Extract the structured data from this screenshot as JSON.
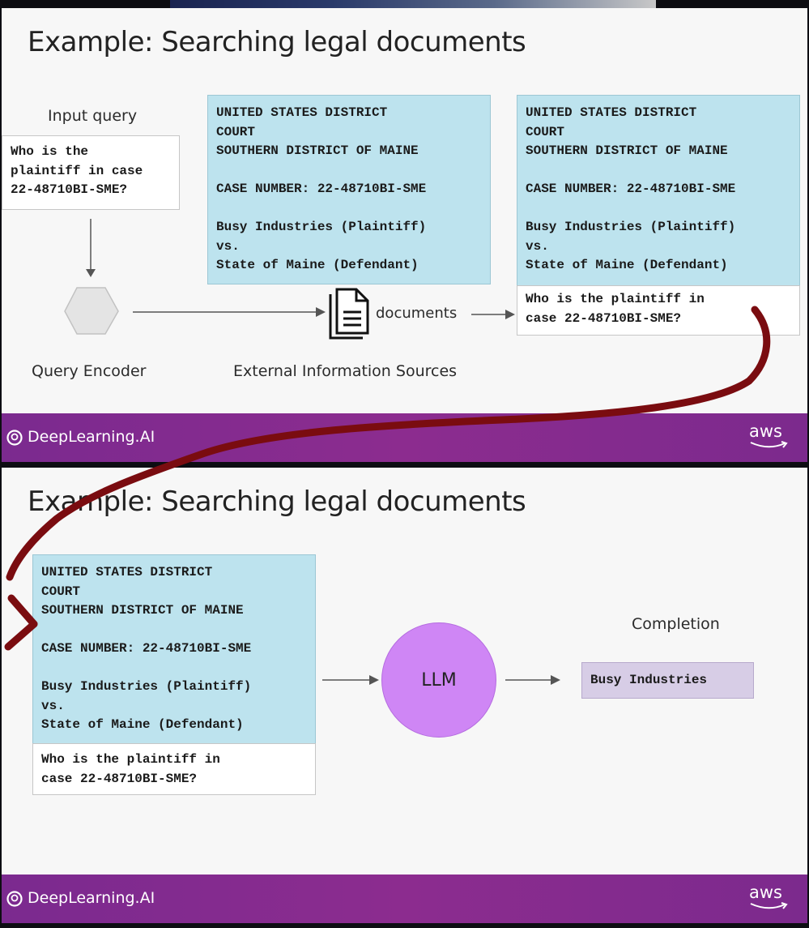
{
  "slide1": {
    "title": "Example: Searching legal documents",
    "input_query_label": "Input query",
    "input_query_text": "Who is the\nplaintiff in case\n22-48710BI-SME?",
    "query_encoder_label": "Query Encoder",
    "external_sources_label": "External Information Sources",
    "documents_label": "documents",
    "document_text": "UNITED STATES DISTRICT\nCOURT\nSOUTHERN DISTRICT OF MAINE\n\nCASE NUMBER: 22-48710BI-SME\n\nBusy Industries (Plaintiff)\nvs.\nState of Maine (Defendant)",
    "augmented_doc_text": "UNITED STATES DISTRICT\nCOURT\nSOUTHERN DISTRICT OF MAINE\n\nCASE NUMBER: 22-48710BI-SME\n\nBusy Industries (Plaintiff)\nvs.\nState of Maine (Defendant)",
    "augmented_question_text": "Who is the plaintiff in\ncase 22-48710BI-SME?"
  },
  "slide2": {
    "title": "Example: Searching legal documents",
    "doc_text": "UNITED STATES DISTRICT\nCOURT\nSOUTHERN DISTRICT OF MAINE\n\nCASE NUMBER: 22-48710BI-SME\n\nBusy Industries (Plaintiff)\nvs.\nState of Maine (Defendant)",
    "question_text": "Who is the plaintiff in\ncase 22-48710BI-SME?",
    "llm_label": "LLM",
    "completion_label": "Completion",
    "completion_text": "Busy Industries"
  },
  "footer": {
    "brand": "DeepLearning.AI",
    "aws": "aws"
  },
  "colors": {
    "doc_blue": "#bde3ee",
    "llm_purple": "#cf86f5",
    "completion_lavender": "#d7cde6",
    "footer_purple": "#8c2c8f",
    "annotation_maroon": "#7a0c10"
  },
  "icons": [
    "hexagon-icon",
    "document-stack-icon",
    "deeplearning-logo-icon",
    "aws-logo-icon"
  ]
}
